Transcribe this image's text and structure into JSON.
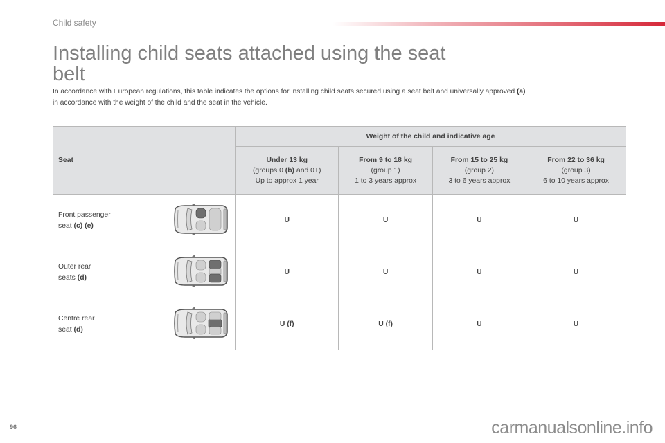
{
  "header": {
    "section": "Child safety",
    "accent_color": "#d62839"
  },
  "title": "Installing child seats attached using the seat belt",
  "intro": {
    "line1": "In accordance with European regulations, this table indicates the options for installing child seats secured using a seat belt and universally approved ",
    "ref_a": "(a)",
    "line2": "in accordance with the weight of the child and the seat in the vehicle."
  },
  "table": {
    "seat_header": "Seat",
    "weight_header": "Weight of the child and indicative age",
    "columns": [
      {
        "title": "Under 13 kg",
        "group_pre": "(groups 0 ",
        "group_ref": "(b)",
        "group_post": " and 0+)",
        "age": "Up to approx 1 year"
      },
      {
        "title": "From 9 to 18 kg",
        "group_pre": "(group 1)",
        "group_ref": "",
        "group_post": "",
        "age": "1 to 3 years approx"
      },
      {
        "title": "From 15 to 25 kg",
        "group_pre": "(group 2)",
        "group_ref": "",
        "group_post": "",
        "age": "3 to 6 years approx"
      },
      {
        "title": "From 22 to 36 kg",
        "group_pre": "(group 3)",
        "group_ref": "",
        "group_post": "",
        "age": "6 to 10 years approx"
      }
    ],
    "rows": [
      {
        "line1": "Front passenger",
        "line2_pre": "seat ",
        "line2_ref": "(c) (e)",
        "highlight": "front-passenger",
        "values": [
          "U",
          "U",
          "U",
          "U"
        ]
      },
      {
        "line1": "Outer rear",
        "line2_pre": "seats ",
        "line2_ref": "(d)",
        "highlight": "outer-rear",
        "values": [
          "U",
          "U",
          "U",
          "U"
        ]
      },
      {
        "line1": "Centre rear",
        "line2_pre": "seat ",
        "line2_ref": "(d)",
        "highlight": "centre-rear",
        "values": [
          "U (f)",
          "U (f)",
          "U",
          "U"
        ]
      }
    ]
  },
  "footer": {
    "page_number": "96",
    "watermark": "carmanualsonline.info"
  }
}
